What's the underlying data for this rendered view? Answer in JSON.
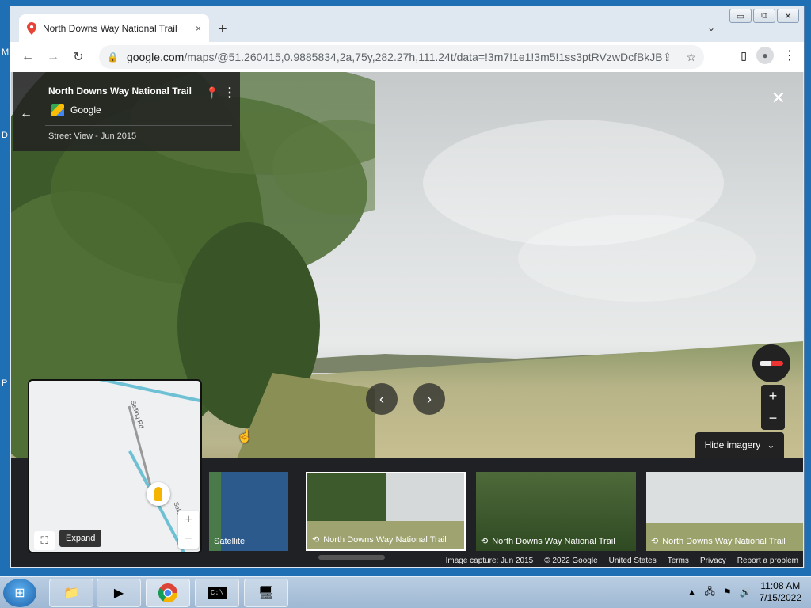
{
  "desktop": {
    "icon_labels": [
      "M",
      "D",
      "P"
    ]
  },
  "window": {
    "controls": {
      "minimize": "▭",
      "maximize": "⧉",
      "close": "✕"
    }
  },
  "browser": {
    "tab": {
      "title": "North Downs Way National Trail",
      "close": "×",
      "favicon": "google-maps-pin-icon"
    },
    "new_tab": "+",
    "tab_menu": "⌄",
    "nav": {
      "back": "←",
      "forward": "→",
      "reload": "↻"
    },
    "url": "google.com/maps/@51.260415,0.9885834,2a,75y,282.27h,111.24t/data=!3m7!1e1!3m5!1ss3ptRVzwDcfBkJB…",
    "url_host": "google.com",
    "url_path": "/maps/@51.260415,0.9885834,2a,75y,282.27h,111.24t/data=!3m7!1e1!3m5!1ss3ptRVzwDcfBkJB…"
  },
  "streetview": {
    "card": {
      "title": "North Downs Way National Trail",
      "brand": "Google",
      "subtitle": "Street View - Jun 2015"
    },
    "hide_imagery": "Hide imagery",
    "thumbnails": [
      {
        "label": "Satellite"
      },
      {
        "label": "North Downs Way National Trail"
      },
      {
        "label": "North Downs Way National Trail"
      },
      {
        "label": "North Downs Way National Trail"
      }
    ],
    "footer": {
      "capture": "Image capture: Jun 2015",
      "copyright": "© 2022 Google",
      "country": "United States",
      "terms": "Terms",
      "privacy": "Privacy",
      "report": "Report a problem"
    },
    "minimap": {
      "road_names": [
        "Selling Rd",
        "Sellin"
      ],
      "expand_tooltip": "Expand",
      "zoom_in": "+",
      "zoom_out": "−"
    },
    "zoom": {
      "in": "+",
      "out": "−"
    }
  },
  "taskbar": {
    "clock_time": "11:08 AM",
    "clock_date": "7/15/2022"
  }
}
